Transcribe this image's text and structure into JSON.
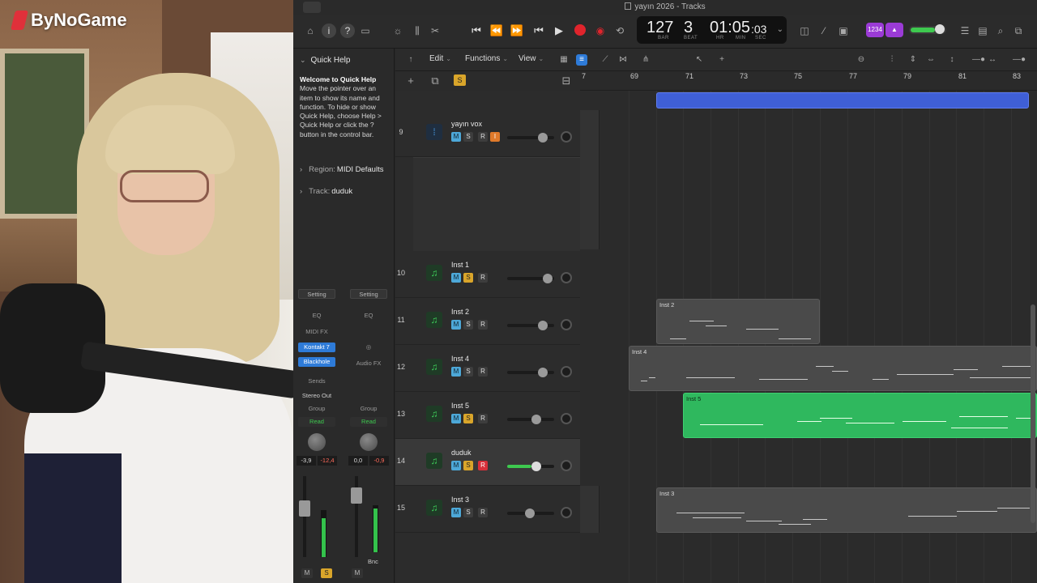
{
  "webcam": {
    "logo_text": "ByNoGame"
  },
  "window": {
    "title": "yayın 2026 - Tracks"
  },
  "lcd": {
    "tempo": "127",
    "beat": "3",
    "time": "01:05",
    "frames": ":03",
    "labels": [
      "BAR",
      "BEAT",
      "HR",
      "MIN",
      "SEC"
    ]
  },
  "purple_badge": "1234",
  "menus": {
    "edit": "Edit",
    "functions": "Functions",
    "view": "View"
  },
  "inspector": {
    "quick_help_title": "Quick Help",
    "quick_help_heading": "Welcome to Quick Help",
    "quick_help_body": "Move the pointer over an item to show its name and function. To hide or show Quick Help, choose Help > Quick Help or click the ? button in the control bar.",
    "region_label": "Region:",
    "region_value": "MIDI Defaults",
    "track_label": "Track:",
    "track_value": "duduk"
  },
  "strip1": {
    "setting": "Setting",
    "eq": "EQ",
    "midi_fx": "MIDI FX",
    "plugin1": "Kontakt 7",
    "plugin2": "Blackhole",
    "sends": "Sends",
    "output": "Stereo Out",
    "group": "Group",
    "auto": "Read",
    "val_a": "-3,9",
    "val_b": "-12,4",
    "mute": "M",
    "solo": "S"
  },
  "strip2": {
    "setting": "Setting",
    "eq": "EQ",
    "audio_fx": "Audio FX",
    "group": "Group",
    "auto": "Read",
    "val_a": "0,0",
    "val_b": "-0,9",
    "bounce": "Bnc",
    "mute": "M"
  },
  "track_header_solo": "S",
  "tracks": [
    {
      "num": "9",
      "name": "yayın vox",
      "type": "audio"
    },
    {
      "num": "10",
      "name": "Inst 1",
      "type": "inst"
    },
    {
      "num": "11",
      "name": "Inst 2",
      "type": "inst"
    },
    {
      "num": "12",
      "name": "Inst 4",
      "type": "inst"
    },
    {
      "num": "13",
      "name": "Inst 5",
      "type": "inst"
    },
    {
      "num": "14",
      "name": "duduk",
      "type": "inst"
    },
    {
      "num": "15",
      "name": "Inst 3",
      "type": "inst"
    }
  ],
  "track_buttons": {
    "m": "M",
    "s": "S",
    "r": "R",
    "i": "I"
  },
  "ruler": {
    "bars": [
      "7",
      "69",
      "71",
      "73",
      "75",
      "77",
      "79",
      "81",
      "83"
    ]
  },
  "regions": {
    "inst2": "Inst 2",
    "inst4": "Inst 4",
    "inst5": "Inst 5",
    "inst3": "Inst 3"
  },
  "colors": {
    "accent_blue": "#2e7bd8",
    "region_green": "#2fb85e",
    "region_blue": "#3f5fd6",
    "solo_yellow": "#d9a52a",
    "record_red": "#e0242c",
    "mute_blue": "#4da8d8"
  }
}
